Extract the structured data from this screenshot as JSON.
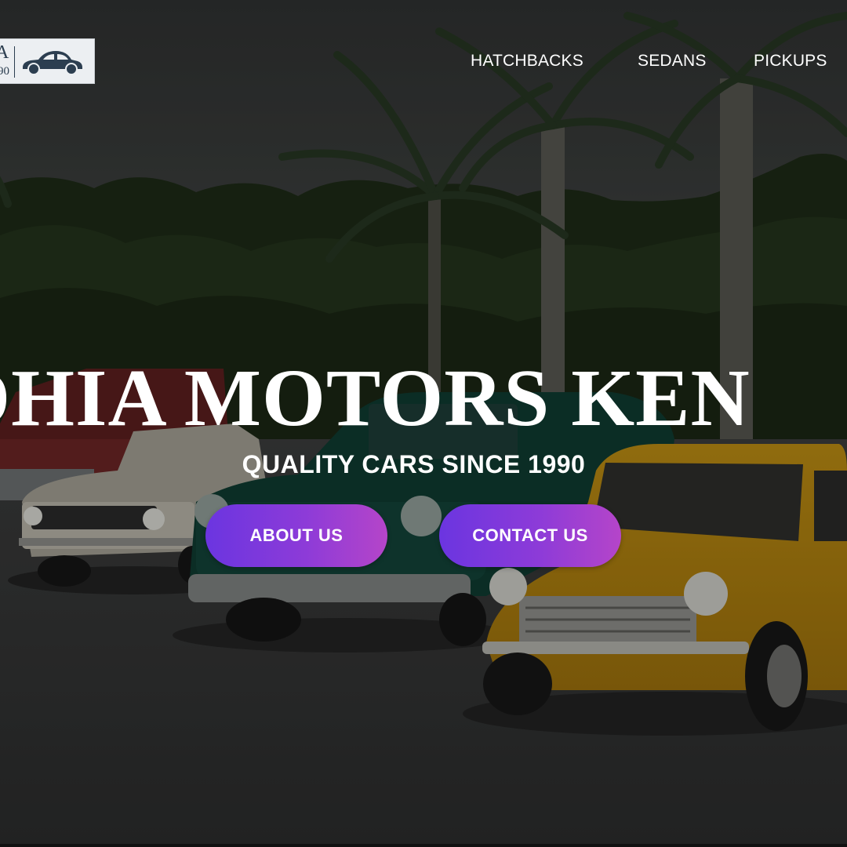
{
  "brand": {
    "logo_letter": "A",
    "logo_year": "90",
    "logo_icon": "car-icon"
  },
  "nav": {
    "items": [
      {
        "label": "HATCHBACKS"
      },
      {
        "label": "SEDANS"
      },
      {
        "label": "PICKUPS"
      }
    ]
  },
  "hero": {
    "title": "DHIA MOTORS KEN",
    "subtitle": "QUALITY CARS SINCE 1990",
    "about_button": "ABOUT US",
    "contact_button": "CONTACT US",
    "button_gradient": [
      "#6b35e0",
      "#b545c9"
    ],
    "overlay_color": "#000000"
  }
}
